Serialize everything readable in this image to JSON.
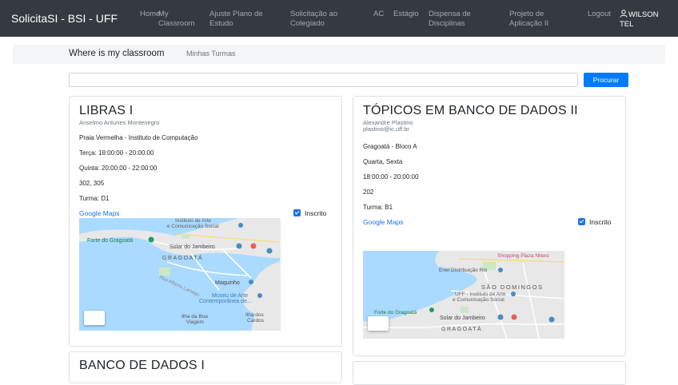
{
  "navbar": {
    "brand": "SolicitaSI - BSI - UFF",
    "items": [
      {
        "label": "Home"
      },
      {
        "label": "My",
        "label2": "Classroom"
      },
      {
        "label": "Ajuste Plano de",
        "label2": "Estudo"
      },
      {
        "label": "Solicitação ao",
        "label2": "Colegiado"
      },
      {
        "label": "AC"
      },
      {
        "label": "Estágio"
      },
      {
        "label": "Dispensa de",
        "label2": "Disciplinas"
      },
      {
        "label": "Projeto de",
        "label2": "Aplicação II"
      },
      {
        "label": "Logout"
      }
    ],
    "user": {
      "line1": "WILSON",
      "line2": "TEL",
      "icon": "user-icon"
    }
  },
  "subheader": {
    "title": "Where is my classroom",
    "link": "Minhas Turmas"
  },
  "search": {
    "value": "",
    "button": "Procurar"
  },
  "cards": [
    {
      "title": "LIBRAS I",
      "professor": "Anselmo Antunes Montenegro",
      "email": "",
      "location": "Praia Vermelha - Instituto de Computação",
      "schedule": [
        "Terça: 18:00:00 - 20:00:00",
        "Quinta: 20:00:00 - 22:00:00"
      ],
      "rooms": "302, 305",
      "turma": "Turma: D1",
      "maps_link": "Google Maps",
      "enrolled_label": "Inscrito",
      "map_labels": [
        "Instituto de Arte",
        "e Comunicação Social",
        "Forte do Gragoatá",
        "Solar do Jambeiro",
        "GRAGOATÁ",
        "Maquinho",
        "Museu de Arte",
        "Contemporânea de...",
        "Ilha da Boa",
        "Viagem",
        "Ilha dos",
        "Cardos",
        "Rua Alberto Lamego"
      ]
    },
    {
      "title": "TÓPICOS EM BANCO DE DADOS II",
      "professor": "Alexandre Plastino",
      "email": "plastino@ic.uff.br",
      "location": "Gragoatá - Bloco A",
      "days": "Quarta, Sexta",
      "time": "18:00:00 - 20:00:00",
      "rooms": "202",
      "turma": "Turma: B1",
      "maps_link": "Google Maps",
      "enrolled_label": "Inscrito",
      "map_labels": [
        "Shopping Plaza Niteró",
        "Enel Distribuição Rio",
        "SÃO DOMINGOS",
        "UFF - Instituto de Arte",
        "e Comunicação Social",
        "Forte do Gragoatá",
        "Solar do Jambeiro",
        "GRAGOATÁ"
      ]
    },
    {
      "title": "BANCO DE DADOS I"
    }
  ],
  "colors": {
    "navbar": "#343a40",
    "accent": "#007bff",
    "link": "#1a73e8",
    "water": "#aadaff",
    "land": "#e8e8e8"
  }
}
